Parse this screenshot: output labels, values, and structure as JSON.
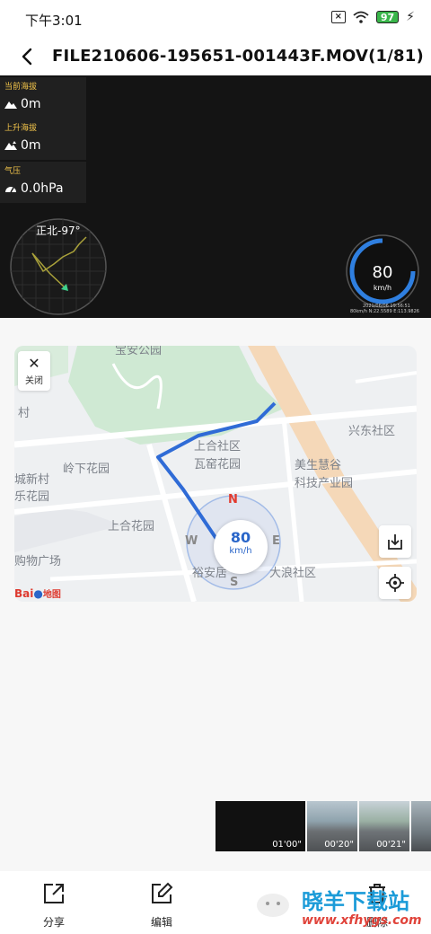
{
  "status_bar": {
    "time": "下午3:01",
    "battery": "97"
  },
  "header": {
    "title": "FILE210606-195651-001443F.MOV(1/81)"
  },
  "video": {
    "hud": [
      {
        "label": "当前海拔",
        "value": "0m",
        "icon": "mountain-icon"
      },
      {
        "label": "上升海拔",
        "value": "0m",
        "icon": "mountain-up-icon"
      },
      {
        "label": "气压",
        "value": "0.0hPa",
        "icon": "pressure-gauge-icon"
      }
    ],
    "heading": "正北-97°",
    "speed": {
      "value": "80",
      "unit": "km/h"
    },
    "stamp_line1": "2021/06/06 19:56:51",
    "stamp_line2": "80km/h N:22.5589 E:113.9826"
  },
  "map": {
    "close_label": "关闭",
    "labels": [
      "宝安公园",
      "兴东社区",
      "上合社区",
      "瓦窑花园",
      "美生慧谷",
      "科技产业园",
      "岭下花园",
      "城新村",
      "乐花园",
      "上合花园",
      "购物广场",
      "裕安居",
      "大浪社区",
      "村"
    ],
    "speed": {
      "value": "80",
      "unit": "km/h"
    },
    "compass": {
      "n": "N",
      "s": "S",
      "e": "E",
      "w": "W"
    },
    "logo_text": "Bai",
    "logo_suffix": "地图",
    "route_color": "#2f6bd6"
  },
  "thumbnails": [
    {
      "time": "01'00\""
    },
    {
      "time": "00'20\""
    },
    {
      "time": "00'21\""
    }
  ],
  "bottom_bar": {
    "share": "分享",
    "edit": "编辑",
    "delete": "删除"
  },
  "watermark": {
    "name": "晓羊下载站",
    "url": "www.xfhygs.com"
  }
}
